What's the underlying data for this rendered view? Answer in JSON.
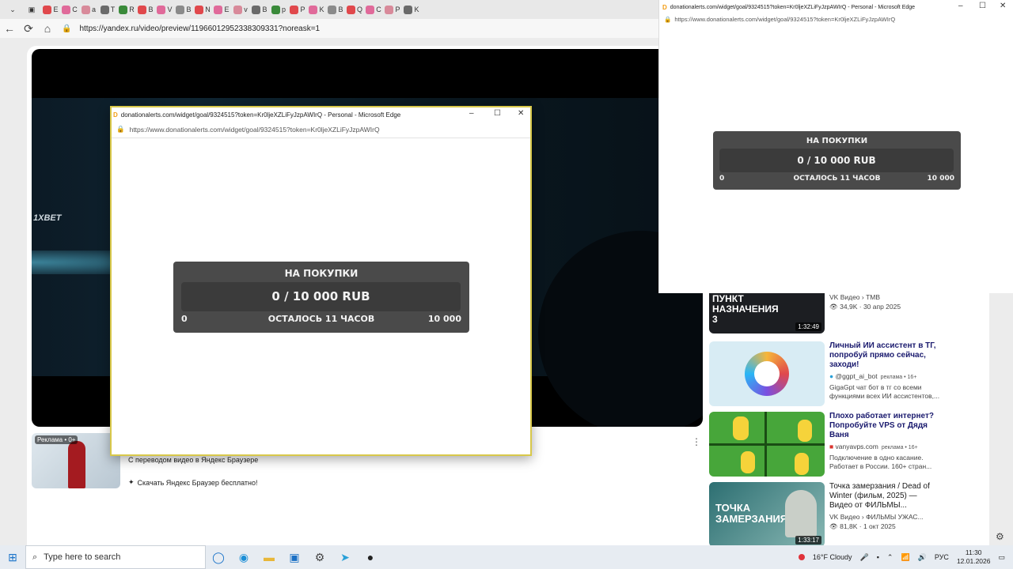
{
  "browser": {
    "tab_letters": [
      "E",
      "C",
      "a",
      "T",
      "R",
      "B",
      "V",
      "B",
      "N",
      "E",
      "v",
      "B",
      "p",
      "P",
      "K",
      "B",
      "Q",
      "C",
      "P",
      "K"
    ],
    "url": "https://yandex.ru/video/preview/11966012952338309331?noreask=1"
  },
  "player": {
    "logo": "1XBET"
  },
  "ad": {
    "badge": "Реклама • 0+",
    "text": "С переводом видео в Яндекс Браузере",
    "link": "Скачать Яндекс Браузер бесплатно!"
  },
  "related": [
    {
      "title": "",
      "thumb_text": "ПУНКТ НАЗНАЧЕНИЯ 3",
      "channel": "VK Видео › TMB",
      "stats": "34,9K · 30 апр 2025",
      "duration": "1:32:49"
    },
    {
      "title": "Личный ИИ ассистент в ТГ, попробуй прямо сейчас, заходи!",
      "channel": "@ggpt_ai_bot",
      "tag": "реклама • 16+",
      "desc": "GigaGpt чат бот в тг со всеми функциями всех ИИ ассистентов,..."
    },
    {
      "title": "Плохо работает интернет? Попробуйте VPS от Дядя Ваня",
      "channel": "vanyavps.com",
      "tag": "реклама • 16+",
      "desc": "Подключение в одно касание. Работает в России. 160+ стран..."
    },
    {
      "title": "Точка замерзания / Dead of Winter (фильм, 2025) — Видео от ФИЛЬМЫ...",
      "thumb_text": "ТОЧКА ЗАМЕРЗАНИЯ",
      "channel": "VK Видео › ФИЛЬМЫ УЖАС...",
      "stats": "81,8K · 1 окт 2025",
      "duration": "1:33:17"
    }
  ],
  "popup1": {
    "title": "donationalerts.com/widget/goal/9324515?token=Kr0ljeXZLiFyJzpAWIrQ - Personal - Microsoft Edge",
    "url": "https://www.donationalerts.com/widget/goal/9324515?token=Kr0ljeXZLiFyJzpAWIrQ"
  },
  "popup2": {
    "title": "donationalerts.com/widget/goal/9324515?token=Kr0ljeXZLiFyJzpAWIrQ - Personal - Microsoft Edge",
    "url": "https://www.donationalerts.com/widget/goal/9324515?token=Kr0ljeXZLiFyJzpAWIrQ"
  },
  "widget": {
    "title": "НА ПОКУПКИ",
    "progress": "0 / 10 000 RUB",
    "min": "0",
    "remaining": "ОСТАЛОСЬ 11 ЧАСОВ",
    "max": "10 000"
  },
  "taskbar": {
    "search_placeholder": "Type here to search",
    "weather": "16°F  Cloudy",
    "lang": "РУС",
    "time": "11:30",
    "date": "12.01.2026"
  },
  "colors": {
    "widget_bg": "#4a4a4a",
    "widget_bar": "#3b3b3b",
    "popup_border": "#d8c84a",
    "link_title": "#1a1a6e"
  }
}
